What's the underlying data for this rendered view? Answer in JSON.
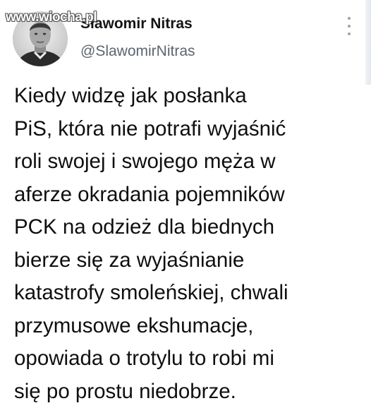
{
  "watermark": "www.wiocha.pl",
  "author": {
    "display_name": "Sławomir Nitras",
    "handle": "@SlawomirNitras"
  },
  "tweet": {
    "lines": [
      "Kiedy widzę jak posłanka",
      "PiS, która nie potrafi wyjaśnić",
      "roli swojej i swojego męża w",
      "aferze okradania pojemników",
      "PCK na odzież dla biednych",
      "bierze się za wyjaśnianie",
      "katastrofy smoleńskiej, chwali",
      "przymusowe ekshumacje,",
      "opowiada o trotylu to robi mi",
      "się po prostu niedobrze."
    ]
  },
  "icons": {
    "more": "more-vertical-icon"
  },
  "colors": {
    "text": "#0f0f0f",
    "handle": "#5b6670",
    "dots": "#9aa3ab",
    "background": "#ffffff"
  }
}
